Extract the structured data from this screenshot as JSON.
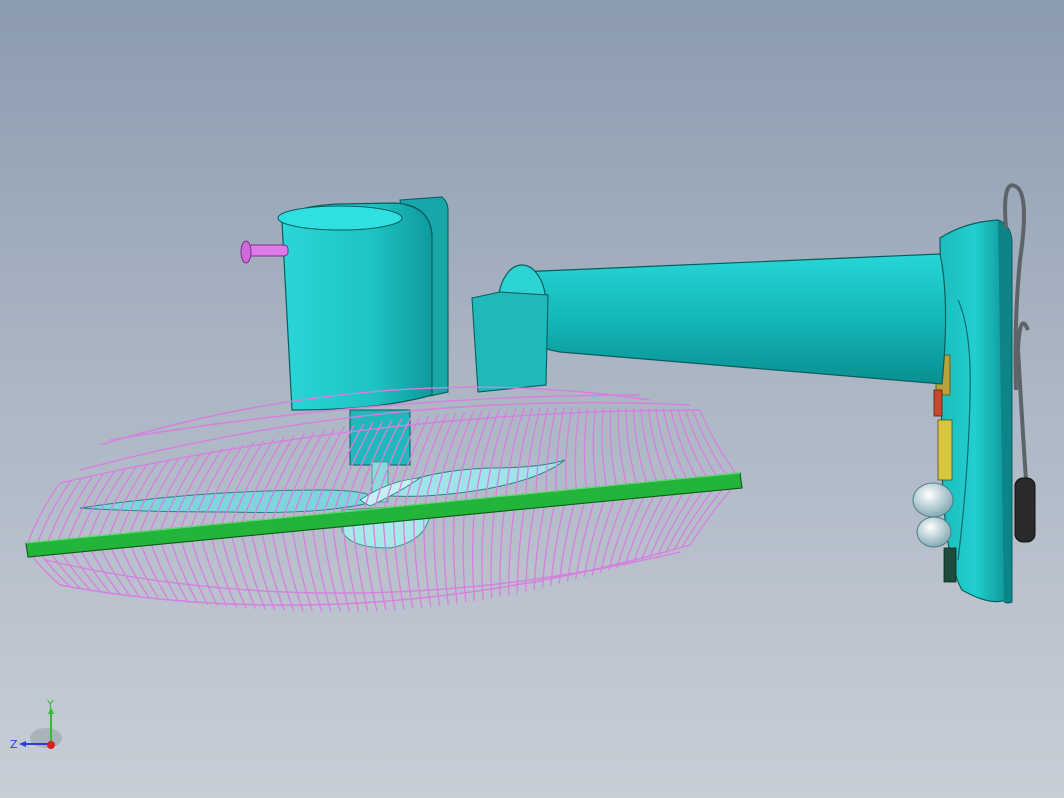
{
  "viewport": {
    "background_top": "#8b9bb0",
    "background_bottom": "#c7ced6"
  },
  "model": {
    "body_color": "#25c9c9",
    "guard_color": "#d77fe0",
    "ring_color": "#22b53a",
    "accent_color": "#e07aeb"
  },
  "triad": {
    "y_label": "Y",
    "z_label": "Z",
    "y_color": "#2fbf2f",
    "z_color": "#2a3fd8",
    "x_color": "#d72020"
  }
}
